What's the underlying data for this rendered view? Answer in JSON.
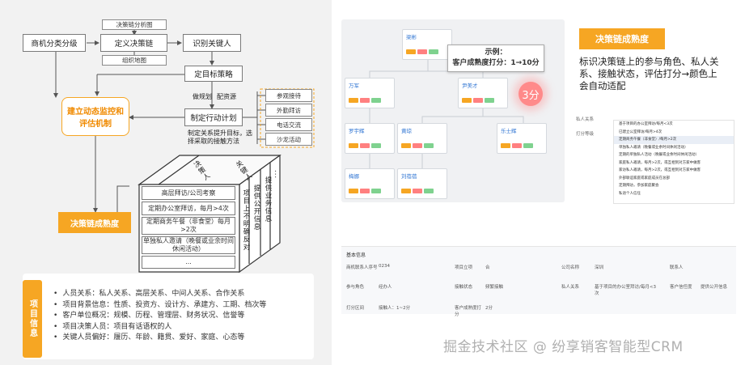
{
  "left": {
    "top_flow": {
      "classify": "商机分类分级",
      "define_chain": "定义决策链",
      "identify_people": "识别关键人",
      "analysis_diagram": "决策链分析图",
      "org_map": "组织地图",
      "set_strategy": "定目标策略",
      "plan_label": "做规划",
      "allocate_label": "配资源",
      "action_plan": "制定行动计划",
      "action_note": "制定关系提升目标，选择采取的接触方法",
      "monitor": "建立动态监控和评估机制",
      "maturity": "决策链成熟度"
    },
    "activities": [
      "参观接待",
      "外勤拜访",
      "电话交流",
      "沙龙活动"
    ],
    "cube": {
      "top_labels": [
        "决策人",
        "关键人"
      ],
      "items": [
        "高层拜访/公司考察",
        "定期办公室拜访，每月>4次",
        "定期商务午餐（非食堂）每月>2次",
        "单独私人邀请（晚餐或业余时间休闲活动）",
        "..."
      ],
      "side_cols": [
        "项目上不明确反对",
        "提供公开信息",
        "提供业务信息",
        "..."
      ]
    },
    "info": {
      "tab": "项目信息",
      "items": [
        "人员关系：私人关系、高层关系、中间人关系、合作关系",
        "项目背景信息：性质、投资方、设计方、承建方、工期、档次等",
        "客户单位概况：规模、历程、管理层、财务状况、信誉等",
        "项目决策人员：项目有话语权的人",
        "关键人员偏好：履历、年龄、籍贯、爱好、家庭、心态等"
      ]
    }
  },
  "right": {
    "callout_line1": "示例：",
    "callout_line2": "客户成熟度打分：1→10分",
    "score": "3分",
    "title": "决策链成熟度",
    "description": "标识决策链上的参与角色、私人关系、接触状态，评估打分→颜色上会自动适配",
    "org_nodes": [
      "梁彬",
      "万军",
      "尹美才",
      "罗宇辉",
      "黄琼",
      "乐士辉",
      "梅娜",
      "刘蓓蓓"
    ],
    "dropdown": {
      "label1": "私人关系",
      "label2": "打分等级",
      "items": [
        "基于项目的办公室拜访/每月<3次",
        "已建立公室拜访/每月>4次",
        "定期商务午餐（非食堂）/每月>2次",
        "单独私人邀请（晚餐或业余时间休闲活动）",
        "定期的单独私人活动（晚餐或业余时间休闲活动）",
        "家庭私人邀请，每月>2次，或互相到对方家中做客",
        "家访私人邀请，每月>2次，或互相到对方家中做客",
        "外部联谊家庭或家庭成员在总部",
        "定期拜访，参加家庭聚会",
        "私语个人信任"
      ]
    },
    "base_info": {
      "header": "基本信息",
      "rows": [
        [
          "商机联系人序号",
          "0234",
          "项目立项",
          "合",
          "公司名称",
          "深圳",
          "联系人",
          ""
        ],
        [
          "参与角色",
          "经办人",
          "接触状态",
          "频繁接触",
          "私人关系",
          "基于项目的办公室拜访/每月<3次",
          "客户信任度",
          "提供公开信息"
        ],
        [
          "打分区间",
          "接触人：1~2分",
          "客户成熟度打分",
          "2分",
          "",
          "",
          "",
          ""
        ]
      ]
    },
    "watermark": "掘金技术社区 @ 纷享销客智能型CRM"
  },
  "colors": {
    "accent": "#f6a623",
    "accent_text": "#f08a00",
    "link_blue": "#3478d4"
  }
}
